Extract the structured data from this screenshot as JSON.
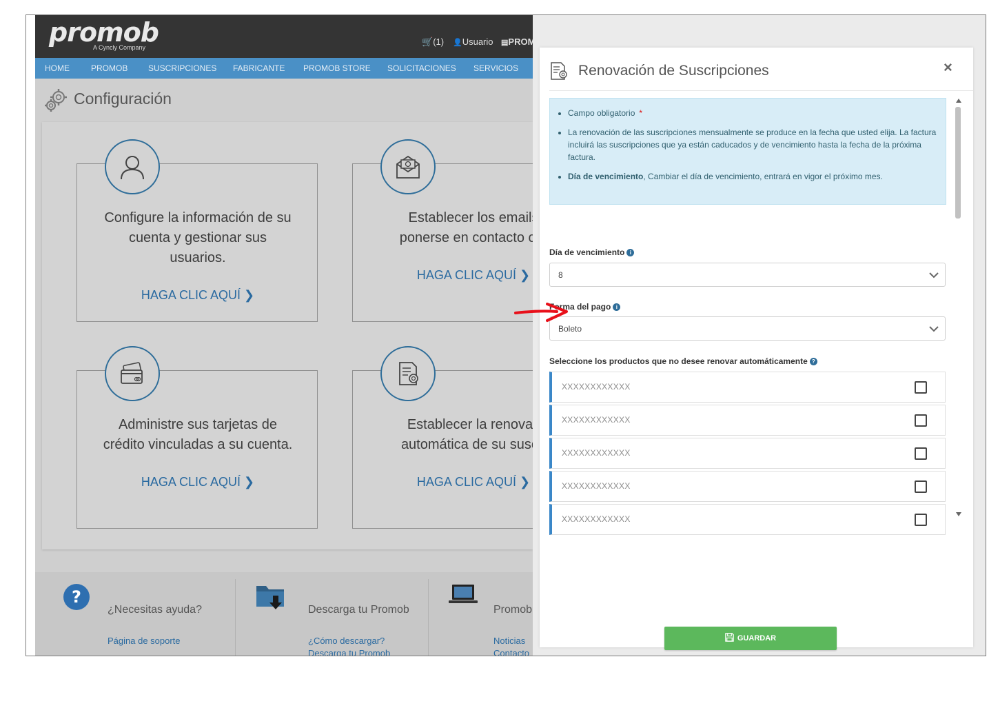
{
  "header": {
    "logo": "promob",
    "logo_sub": "A Cyncly Company",
    "cart_label": "(1)",
    "user_label": "Usuario",
    "promob_label": "PROM"
  },
  "nav": {
    "items": [
      "HOME",
      "PROMOB",
      "SUSCRIPCIONES",
      "FABRICANTE",
      "PROMOB STORE",
      "SOLICITACIONES",
      "SERVICIOS"
    ]
  },
  "page": {
    "title": "Configuración"
  },
  "cards": [
    {
      "text_line1": "Configure la información de su",
      "text_line2": "cuenta y gestionar sus",
      "text_line3": "usuarios.",
      "link": "HAGA CLIC AQUÍ ❯",
      "icon": "user-icon"
    },
    {
      "text_line1": "Establecer los emails",
      "text_line2": "ponerse en contacto cor",
      "text_line3": "",
      "link": "HAGA CLIC AQUÍ ❯",
      "icon": "email-icon"
    },
    {
      "text_line1": "Administre sus tarjetas de",
      "text_line2": "crédito vinculadas a su cuenta.",
      "text_line3": "",
      "link": "HAGA CLIC AQUÍ ❯",
      "icon": "credit-card-icon"
    },
    {
      "text_line1": "Establecer la renovac",
      "text_line2": "automática de su suscri",
      "text_line3": "",
      "link": "HAGA CLIC AQUÍ ❯",
      "icon": "certificate-icon"
    }
  ],
  "footer": {
    "help_title": "¿Necesitas ayuda?",
    "help_link": "Página de soporte",
    "download_title": "Descarga tu Promob",
    "download_link1": "¿Cómo descargar?",
    "download_link2": "Descarga tu Promob",
    "promob_title": "Promob",
    "promob_link1": "Noticias",
    "promob_link2": "Contacto"
  },
  "modal": {
    "title": "Renovación de Suscripciones",
    "close": "×",
    "info": {
      "item1": "Campo obligatorio",
      "item1_required": "*",
      "item2": "La renovación de las suscripciones mensualmente se produce en la fecha que usted elija. La factura incluirá las suscripciones que ya están caducados y de vencimiento hasta la fecha de la próxima factura.",
      "item3_bold": "Día de vencimiento",
      "item3": ", Cambiar el día de vencimiento, entrará en vigor el próximo mes."
    },
    "due_day_label": "Día de vencimiento",
    "due_day_value": "8",
    "payment_label": "Forma del pago",
    "payment_value": "Boleto",
    "products_label": "Seleccione los productos que no desee renovar automáticamente",
    "products": [
      "XXXXXXXXXXXX",
      "XXXXXXXXXXXX",
      "XXXXXXXXXXXX",
      "XXXXXXXXXXXX",
      "XXXXXXXXXXXX"
    ],
    "save_label": "GUARDAR"
  },
  "colors": {
    "nav_blue": "#4a90c6",
    "topbar": "#343434",
    "link_blue": "#2a6aa0",
    "save_green": "#5cb85c",
    "info_bg": "#d8edf7",
    "annotation_arrow": "#e8101a"
  }
}
